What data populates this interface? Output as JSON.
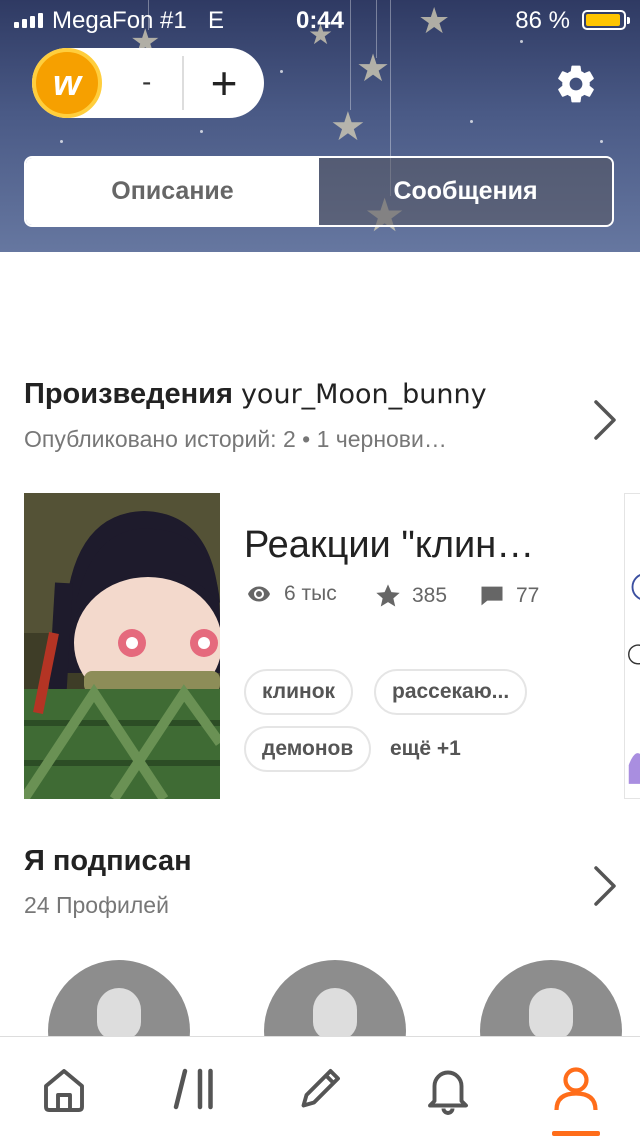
{
  "status_bar": {
    "carrier": "MegaFon #1",
    "network": "E",
    "time": "0:44",
    "battery_percent": "86 %"
  },
  "wallet": {
    "coin_symbol": "w",
    "minus_label": "-",
    "plus_label": "+"
  },
  "tabs": {
    "description": "Описание",
    "messages": "Сообщения"
  },
  "works": {
    "title_prefix": "Произведения",
    "username": "your_Moon_bunny",
    "subtitle": "Опубликовано историй: 2 • 1 чернови…",
    "story": {
      "title": "Реакции \"клин…",
      "views": "6 тыс",
      "votes": "385",
      "comments": "77",
      "tags": [
        "клинок",
        "рассекаю...",
        "демонов"
      ],
      "more_tags": "ещё +1"
    }
  },
  "following": {
    "title": "Я подписан",
    "subtitle": "24 Профилей"
  },
  "nav": {
    "items": [
      "home-icon",
      "library-icon",
      "write-icon",
      "notifications-icon",
      "profile-icon"
    ],
    "active_index": 4,
    "accent": "#ff6d1a"
  }
}
